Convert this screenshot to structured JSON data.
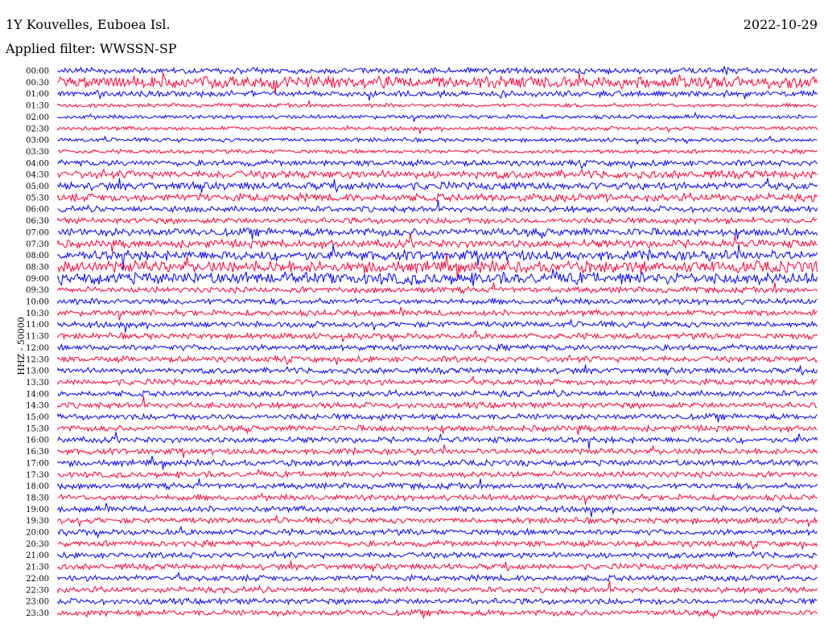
{
  "header": {
    "station": "1Y Kouvelles, Euboea Isl.",
    "date": "2022-10-29",
    "filter": "Applied filter: WWSSN-SP"
  },
  "chart_data": {
    "type": "line",
    "title": "1Y Kouvelles, Euboea Isl.",
    "ylabel": "HHZ - 50000",
    "colors": [
      "#0000ff",
      "#ff0033"
    ],
    "row_labels": [
      "00:00",
      "00:30",
      "01:00",
      "01:30",
      "02:00",
      "02:30",
      "03:00",
      "03:30",
      "04:00",
      "04:30",
      "05:00",
      "05:30",
      "06:00",
      "06:30",
      "07:00",
      "07:30",
      "08:00",
      "08:30",
      "09:00",
      "09:30",
      "10:00",
      "10:30",
      "11:00",
      "11:30",
      "12:00",
      "12:30",
      "13:00",
      "13:30",
      "14:00",
      "14:30",
      "15:00",
      "15:30",
      "16:00",
      "16:30",
      "17:00",
      "17:30",
      "18:00",
      "18:30",
      "19:00",
      "19:30",
      "20:00",
      "20:30",
      "21:00",
      "21:30",
      "22:00",
      "22:30",
      "23:00",
      "23:30"
    ],
    "noise_level": [
      3,
      6,
      3,
      2,
      2,
      2,
      2,
      2,
      3,
      4,
      4,
      4,
      3,
      3,
      4,
      4,
      5,
      6,
      6,
      3,
      3,
      3,
      3,
      3,
      3,
      3,
      3,
      3,
      3,
      3,
      3,
      3,
      3,
      3,
      3,
      3,
      3,
      3,
      3,
      3,
      3,
      3,
      3,
      3,
      3,
      3,
      3,
      3
    ]
  }
}
